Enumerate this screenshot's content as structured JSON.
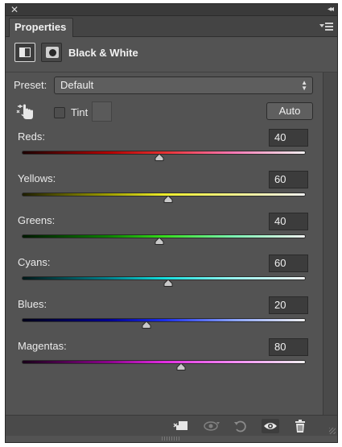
{
  "panel": {
    "close_icon": "close-icon",
    "collapse_icon": "collapse-icon",
    "tab_label": "Properties",
    "menu_icon": "panel-menu-icon"
  },
  "adjustment": {
    "title": "Black & White",
    "icons": [
      "adjustment-icon",
      "mask-icon"
    ]
  },
  "preset": {
    "label": "Preset:",
    "value": "Default"
  },
  "tint": {
    "label": "Tint",
    "checked": false,
    "swatch_color": "#5a5a5a"
  },
  "auto_label": "Auto",
  "sliders": [
    {
      "label": "Reds:",
      "value": "40",
      "fraction": 0.485,
      "gradient": [
        "#1b0000",
        "#b00000",
        "#e53131",
        "#ff7ab6",
        "#f0f0f0"
      ]
    },
    {
      "label": "Yellows:",
      "value": "60",
      "fraction": 0.515,
      "gradient": [
        "#1d1d00",
        "#9c9c00",
        "#ecec2a",
        "#f4f48c",
        "#f0f0f0"
      ]
    },
    {
      "label": "Greens:",
      "value": "40",
      "fraction": 0.485,
      "gradient": [
        "#001800",
        "#0b7e00",
        "#36dc1d",
        "#7cf4b4",
        "#f0f0f0"
      ]
    },
    {
      "label": "Cyans:",
      "value": "60",
      "fraction": 0.515,
      "gradient": [
        "#001818",
        "#007f8a",
        "#13dcdc",
        "#99f5f0",
        "#f0f0f0"
      ]
    },
    {
      "label": "Blues:",
      "value": "20",
      "fraction": 0.44,
      "gradient": [
        "#000018",
        "#00008c",
        "#1a2dea",
        "#8aa3ff",
        "#f0f0f0"
      ]
    },
    {
      "label": "Magentas:",
      "value": "80",
      "fraction": 0.56,
      "gradient": [
        "#180018",
        "#8a008a",
        "#e12ce1",
        "#f58cf5",
        "#f0f0f0"
      ]
    }
  ],
  "bottom_icons": [
    "clip-to-layer-icon",
    "view-previous-icon",
    "reset-icon",
    "visibility-eye-icon",
    "trash-icon"
  ]
}
